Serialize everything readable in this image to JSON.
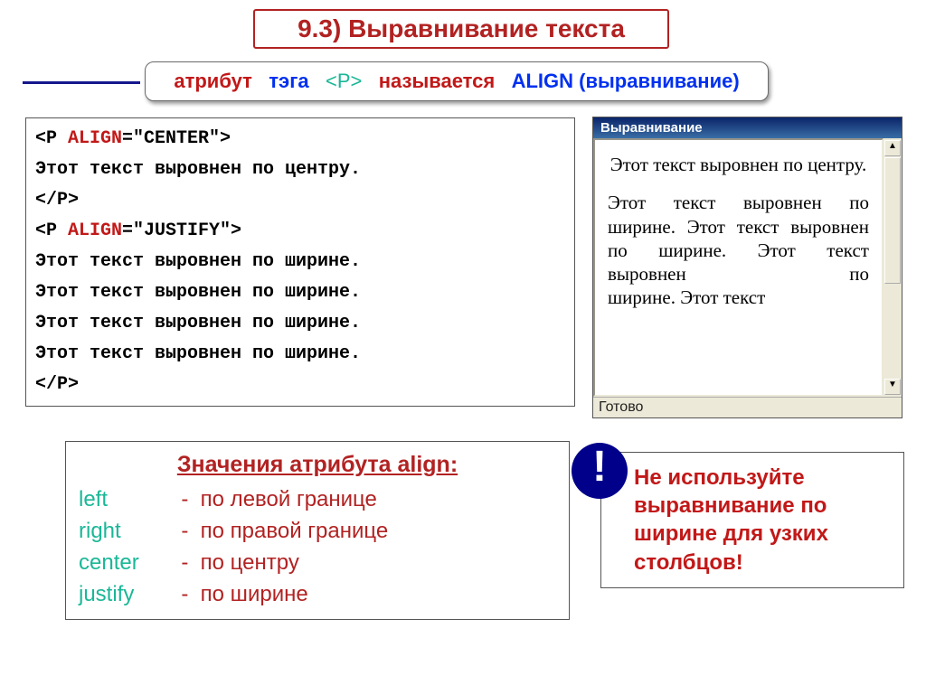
{
  "title": "9.3) Выравнивание текста",
  "subtitle": {
    "word1": "атрибут",
    "word2": "тэга",
    "tag": "<P>",
    "word3": "называется",
    "word4": "ALIGN (выравнивание)"
  },
  "code": {
    "l1a": "<P ",
    "l1b": "ALIGN",
    "l1c": "=\"CENTER\">",
    "l2": "Этот текст выровнен по центру.",
    "l3": "</P>",
    "l4a": "<P ",
    "l4b": "ALIGN",
    "l4c": "=\"JUSTIFY\">",
    "l5": "Этот текст выровнен по ширине.",
    "l6": "Этот текст выровнен по ширине.",
    "l7": "Этот текст выровнен по ширине.",
    "l8": "Этот текст выровнен по ширине.",
    "l9": "</P>"
  },
  "browser": {
    "title": "Выравнивание",
    "center_text": "Этот текст выровнен по центру.",
    "justify_text": "Этот текст выровнен по ширине. Этот текст выровнен по ширине. Этот текст выровнен по",
    "justify_last": "ширине. Этот текст",
    "status": "Готово"
  },
  "values": {
    "heading": "Значения атрибута align:",
    "rows": [
      {
        "key": "left",
        "desc": "по левой границе"
      },
      {
        "key": "right",
        "desc": "по правой границе"
      },
      {
        "key": "center",
        "desc": "по центру"
      },
      {
        "key": "justify",
        "desc": "по ширине"
      }
    ],
    "sep": "  -  "
  },
  "warning": {
    "mark": "!",
    "text": "Не используйте выравнивание по ширине для узких столбцов!"
  }
}
